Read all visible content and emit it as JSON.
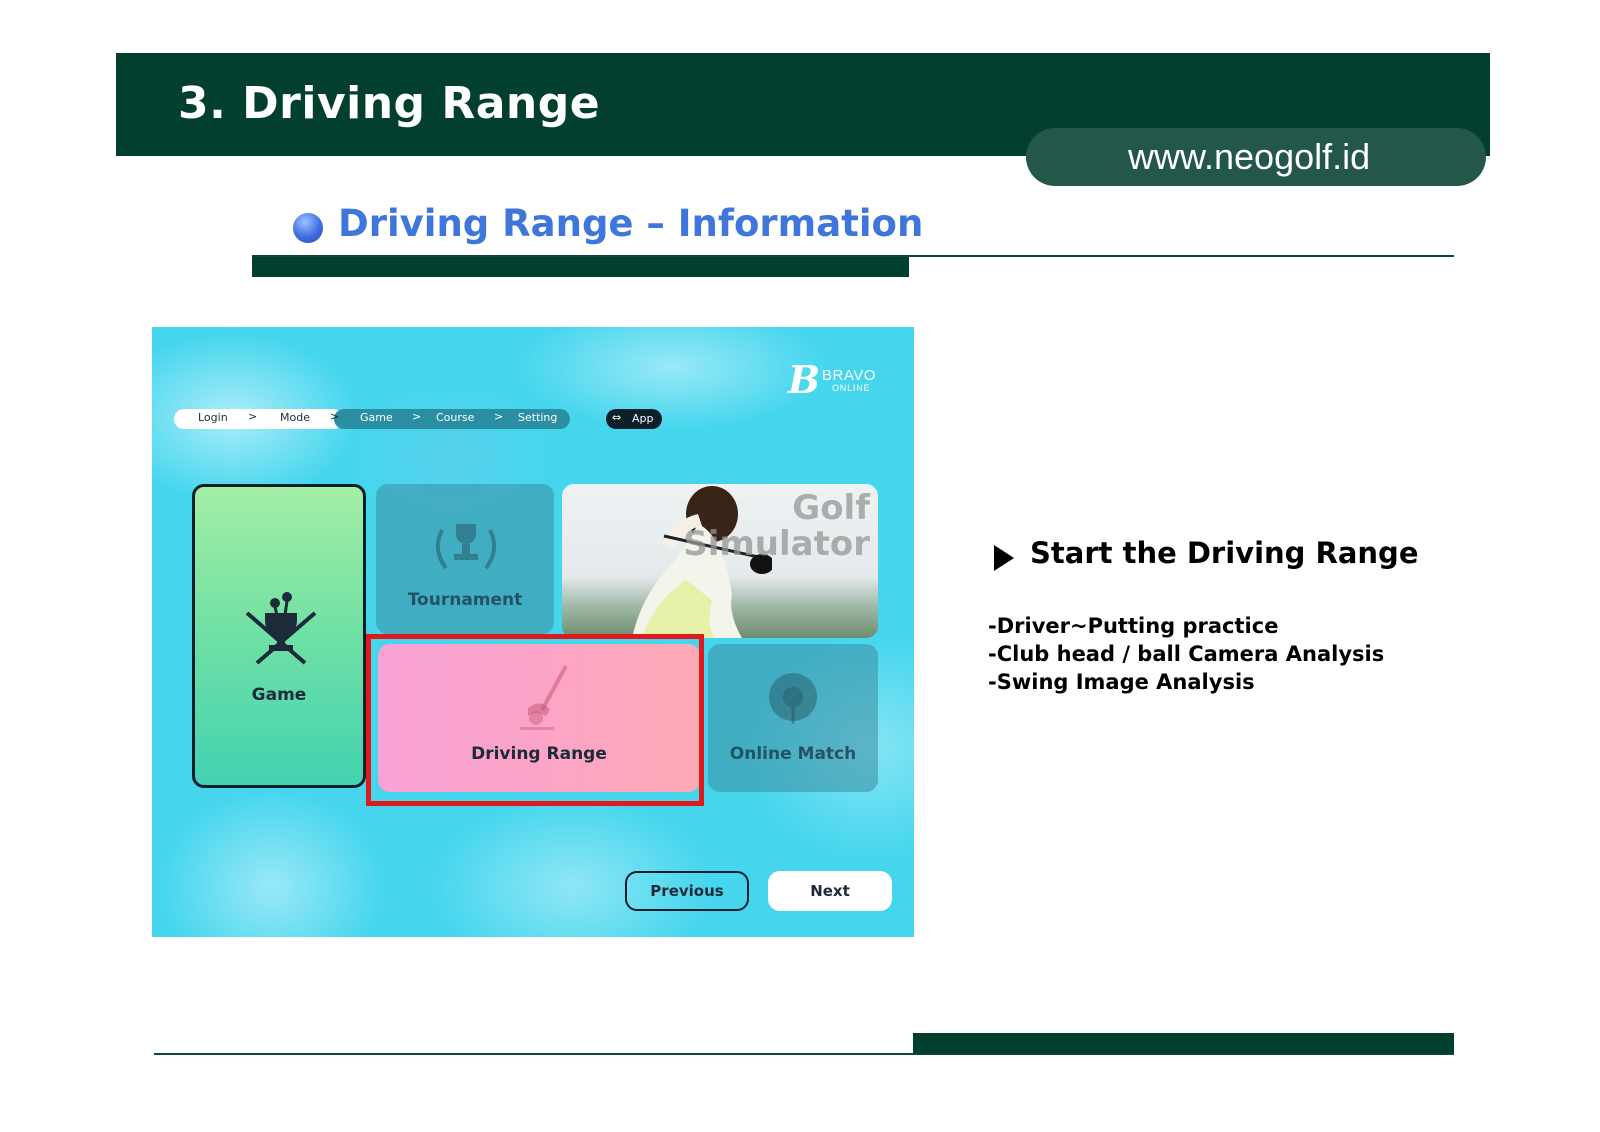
{
  "header": {
    "title": "3. Driving Range",
    "url": "www.neogolf.id"
  },
  "section": {
    "title": "Driving Range – Information"
  },
  "screenshot": {
    "brand": {
      "name": "BRAVO",
      "subtitle": "ONLINE",
      "mark": "B"
    },
    "breadcrumb": {
      "items": [
        "Login",
        "Mode",
        "Game",
        "Course",
        "Setting"
      ],
      "separator": ">",
      "app_label": "App",
      "app_icon": "swap-arrows-icon"
    },
    "cards": {
      "game": {
        "label": "Game",
        "icon": "golf-trophy-clubs-icon"
      },
      "tournament": {
        "label": "Tournament",
        "icon": "laurel-trophy-icon"
      },
      "photo": {
        "title_line1": "Golf",
        "title_line2": "Simulator"
      },
      "driving_range": {
        "label": "Driving Range",
        "icon": "golf-club-ball-icon"
      },
      "online_match": {
        "label": "Online Match",
        "icon": "globe-golf-icon"
      }
    },
    "buttons": {
      "previous": "Previous",
      "next": "Next"
    },
    "colors": {
      "background": "#45d6ee",
      "highlight": "#e01a1a",
      "selected": "#fca5c4"
    }
  },
  "info": {
    "title": "Start the Driving Range",
    "lines": [
      "-Driver~Putting practice",
      "-Club head / ball Camera Analysis",
      "-Swing Image Analysis"
    ]
  },
  "colors": {
    "brand_dark_green": "#033f2e",
    "section_title_blue": "#3e76dc"
  }
}
